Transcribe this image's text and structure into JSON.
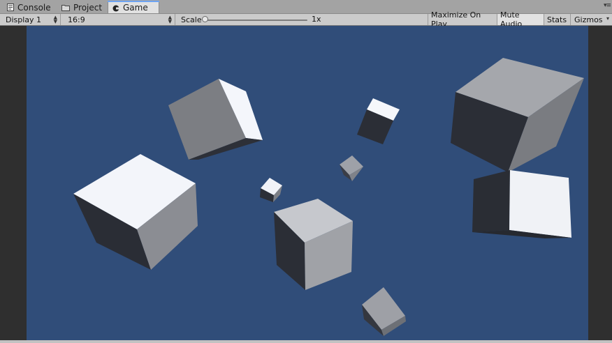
{
  "tabs": [
    {
      "label": "Console",
      "icon": "console-icon",
      "active": false
    },
    {
      "label": "Project",
      "icon": "folder-icon",
      "active": false
    },
    {
      "label": "Game",
      "icon": "game-controller-icon",
      "active": true
    }
  ],
  "toolbar": {
    "display": "Display 1",
    "aspect": "16:9",
    "scale_label": "Scale",
    "scale_value": "1x",
    "scale_slider_fraction": 0,
    "maximize_on_play": "Maximize On Play",
    "mute_audio": "Mute Audio",
    "stats": "Stats",
    "gizmos": "Gizmos"
  },
  "colors": {
    "sky": "#304d79",
    "letterbox": "#2f2f2f",
    "active_tab_accent": "#6da3f2"
  },
  "scene": {
    "description_objects": "cubes"
  }
}
